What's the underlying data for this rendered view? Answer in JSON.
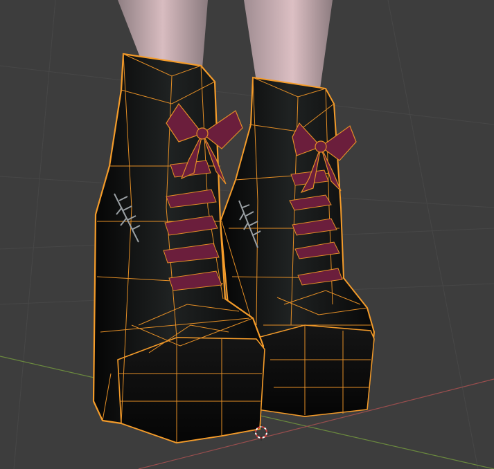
{
  "viewport": {
    "background": "#3d3d3d",
    "grid_color": "#474747",
    "x_axis_color": "#9a4e4e",
    "y_axis_color": "#6b8a3e"
  },
  "selection": {
    "outline_color": "#f59c2a",
    "wire_color": "#e58f26"
  },
  "materials": {
    "boot": "#0c0c0c",
    "bow": "#6b1e3c",
    "leg": "#c9a9ae"
  },
  "objects": [
    {
      "name_hint": "left-boot",
      "selected": true
    },
    {
      "name_hint": "right-boot",
      "selected": true
    }
  ],
  "gizmo": {
    "icon": "3d-cursor-icon"
  }
}
